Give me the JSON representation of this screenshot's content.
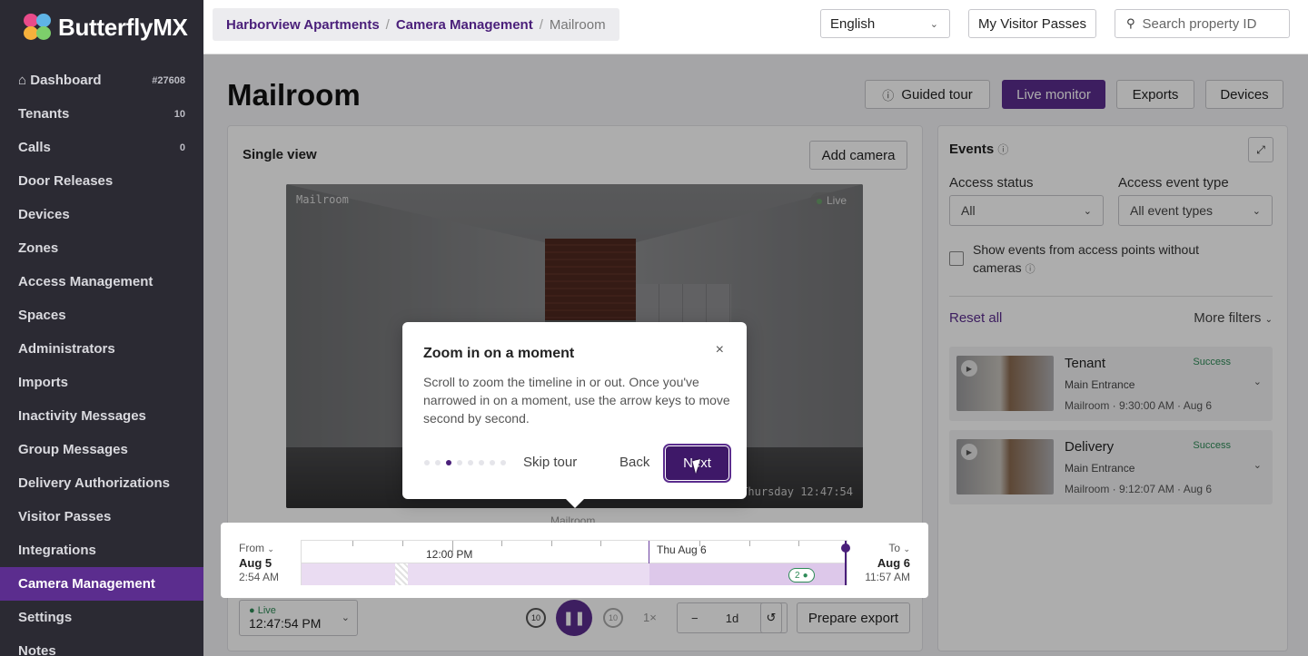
{
  "brand": {
    "name": "ButterflyMX",
    "colors": {
      "accent": "#5b2d8e",
      "sidebar": "#2b2a33",
      "success": "#2e8b57"
    }
  },
  "sidebar": {
    "items": [
      {
        "label": "Dashboard",
        "badge": "#27608",
        "icon": "home-icon"
      },
      {
        "label": "Tenants",
        "badge": "10"
      },
      {
        "label": "Calls",
        "badge": "0"
      },
      {
        "label": "Door Releases",
        "badge": ""
      },
      {
        "label": "Devices",
        "badge": ""
      },
      {
        "label": "Zones",
        "badge": ""
      },
      {
        "label": "Access Management",
        "badge": ""
      },
      {
        "label": "Spaces",
        "badge": ""
      },
      {
        "label": "Administrators",
        "badge": ""
      },
      {
        "label": "Imports",
        "badge": ""
      },
      {
        "label": "Inactivity Messages",
        "badge": ""
      },
      {
        "label": "Group Messages",
        "badge": ""
      },
      {
        "label": "Delivery Authorizations",
        "badge": ""
      },
      {
        "label": "Visitor Passes",
        "badge": ""
      },
      {
        "label": "Integrations",
        "badge": ""
      },
      {
        "label": "Camera Management",
        "badge": "",
        "active": true
      },
      {
        "label": "Settings",
        "badge": ""
      },
      {
        "label": "Notes",
        "badge": ""
      }
    ]
  },
  "header": {
    "breadcrumb": [
      "Harborview Apartments",
      "Camera Management",
      "Mailroom"
    ],
    "language": "English",
    "visitor_passes_btn": "My Visitor Passes",
    "search_placeholder": "Search property ID"
  },
  "page": {
    "title": "Mailroom",
    "actions": {
      "guided_tour": "Guided tour",
      "live_monitor": "Live monitor",
      "exports": "Exports",
      "devices": "Devices"
    }
  },
  "viewer": {
    "title": "Single view",
    "add_camera": "Add camera",
    "camera_name": "Mailroom",
    "live_badge": "Live",
    "timestamp": "Thursday 12:47:54"
  },
  "timeline": {
    "from_label": "From",
    "from_date": "Aug 5",
    "from_time": "2:54 AM",
    "to_label": "To",
    "to_date": "Aug 6",
    "to_time": "11:57 AM",
    "tick_noon": "12:00 PM",
    "day_marker": "Thu Aug 6",
    "event_count": "2",
    "camera_label": "Mailroom"
  },
  "controls": {
    "live_status": "Live",
    "live_time": "12:47:54 PM",
    "speed": "1×",
    "zoom_level": "1d",
    "prepare_export": "Prepare export",
    "rewind_seconds": "10",
    "forward_seconds": "10"
  },
  "events": {
    "title": "Events",
    "access_status_label": "Access status",
    "access_status_value": "All",
    "access_type_label": "Access event type",
    "access_type_value": "All event types",
    "checkbox_label": "Show events from access points without cameras",
    "reset": "Reset all",
    "more_filters": "More filters",
    "items": [
      {
        "title": "Tenant",
        "status": "Success",
        "location": "Main Entrance",
        "meta": "Mailroom · 9:30:00 AM · Aug 6"
      },
      {
        "title": "Delivery",
        "status": "Success",
        "location": "Main Entrance",
        "meta": "Mailroom · 9:12:07 AM · Aug 6"
      }
    ]
  },
  "tour": {
    "title": "Zoom in on a moment",
    "body": "Scroll to zoom the timeline in or out. Once you've narrowed in on a moment, use the arrow keys to move second by second.",
    "skip": "Skip tour",
    "back": "Back",
    "next": "Next",
    "step": 3,
    "total_steps": 8
  }
}
